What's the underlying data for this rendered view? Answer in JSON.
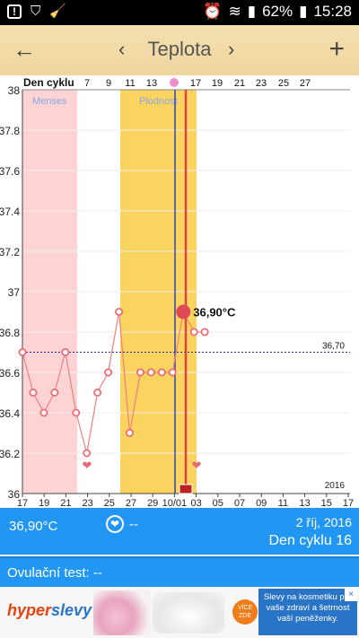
{
  "status_bar": {
    "battery": "62%",
    "time": "15:28"
  },
  "app_bar": {
    "title": "Teplota",
    "back_icon": "arrow-left-icon",
    "prev_icon": "chevron-left-icon",
    "next_icon": "chevron-right-icon",
    "add_icon": "plus-icon"
  },
  "chart_data": {
    "type": "line",
    "top_axis_label": "Den cyklu",
    "top_ticks": [
      "7",
      "9",
      "11",
      "13",
      "17",
      "19",
      "21",
      "23",
      "25",
      "27"
    ],
    "x_ticks": [
      "17",
      "19",
      "21",
      "23",
      "25",
      "27",
      "29",
      "10/01",
      "03",
      "05",
      "07",
      "09",
      "11",
      "13",
      "15",
      "17"
    ],
    "y_ticks": [
      "36",
      "36.2",
      "36.4",
      "36.6",
      "36.8",
      "37",
      "37.2",
      "37.4",
      "37.6",
      "37.8",
      "38"
    ],
    "ylim": [
      36,
      38
    ],
    "year_label": "2016",
    "bands": [
      {
        "name": "Menses",
        "color": "#fdd3d3"
      },
      {
        "name": "Plodnost",
        "color": "#fbd35f"
      }
    ],
    "coverline": {
      "value": 36.7,
      "label": "36,70",
      "color": "#2222cc"
    },
    "series_color": "#f08080",
    "points": [
      {
        "day": 0,
        "value": 36.7
      },
      {
        "day": 1,
        "value": 36.5
      },
      {
        "day": 2,
        "value": 36.4
      },
      {
        "day": 3,
        "value": 36.5
      },
      {
        "day": 4,
        "value": 36.7
      },
      {
        "day": 5,
        "value": 36.4
      },
      {
        "day": 6,
        "value": 36.2
      },
      {
        "day": 7,
        "value": 36.5
      },
      {
        "day": 8,
        "value": 36.6
      },
      {
        "day": 9,
        "value": 36.9
      },
      {
        "day": 10,
        "value": 36.3
      },
      {
        "day": 11,
        "value": 36.6
      },
      {
        "day": 12,
        "value": 36.6
      },
      {
        "day": 13,
        "value": 36.6
      },
      {
        "day": 14,
        "value": 36.6
      },
      {
        "day": 15,
        "value": 36.9
      },
      {
        "day": 16,
        "value": 36.8
      },
      {
        "day": 17,
        "value": 36.8
      }
    ],
    "selected": {
      "day": 15,
      "label": "36,90°C"
    },
    "hearts_days": [
      6,
      16
    ]
  },
  "info": {
    "temperature": "36,90°C",
    "intercourse": "--",
    "date": "2 říj, 2016",
    "cycle_day": "Den cyklu 16",
    "ovulation_test": "Ovulační test: --"
  },
  "ad": {
    "brand_part1": "hyper",
    "brand_part2": "slevy",
    "more_label": "VÍCE ZDE",
    "text": "Slevy na kosmetiku pro vaše zdraví a šetrnost vaší peněženky.",
    "close_icon": "close-icon"
  }
}
